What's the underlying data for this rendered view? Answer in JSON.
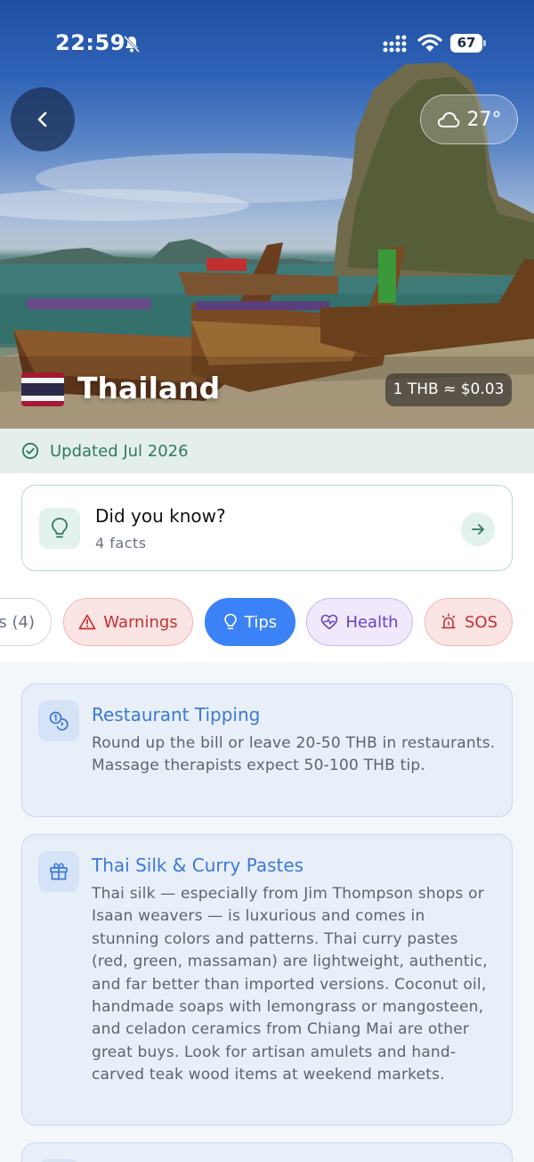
{
  "status_bar": {
    "time": "22:59",
    "battery": "67"
  },
  "hero": {
    "country": "Thailand",
    "weather": {
      "icon": "cloud-icon",
      "temperature": "27°"
    },
    "currency": "1 THB ≈ $0.03",
    "flag_colors": [
      "#a51931",
      "#f4f5f8",
      "#2d2a4a",
      "#f4f5f8",
      "#a51931"
    ]
  },
  "updated": {
    "label": "Updated Jul 2026"
  },
  "did_you_know": {
    "title": "Did you know?",
    "subtitle": "4 facts"
  },
  "tabs": [
    {
      "label": "s (4)",
      "icon": ""
    },
    {
      "label": "Warnings",
      "icon": "warning-triangle-icon"
    },
    {
      "label": "Tips",
      "icon": "lightbulb-icon",
      "active": true
    },
    {
      "label": "Health",
      "icon": "heart-pulse-icon"
    },
    {
      "label": "SOS",
      "icon": "siren-icon"
    }
  ],
  "tips": [
    {
      "icon": "coins-icon",
      "title": "Restaurant Tipping",
      "body": "Round up the bill or leave 20-50 THB in restaurants. Massage therapists expect 50-100 THB tip."
    },
    {
      "icon": "gift-icon",
      "title": "Thai Silk & Curry Pastes",
      "body": "Thai silk — especially from Jim Thompson shops or Isaan weavers — is luxurious and comes in stunning colors and patterns. Thai curry pastes (red, green, massaman) are lightweight, authentic, and far better than imported versions. Coconut oil, handmade soaps with lemongrass or mangosteen, and celadon ceramics from Chiang Mai are other great buys. Look for artisan amulets and hand-carved teak wood items at weekend markets."
    }
  ],
  "colors": {
    "accent": "#3b82f6",
    "updated_green": "#2f7a5c",
    "tip_title_blue": "#3b78d6"
  }
}
